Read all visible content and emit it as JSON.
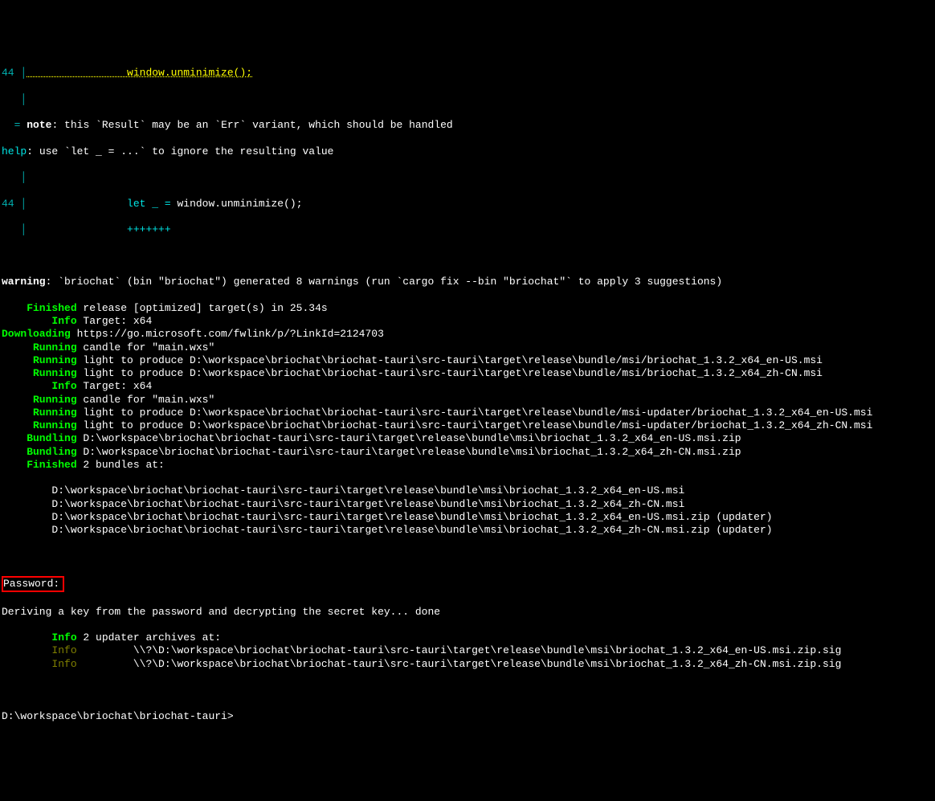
{
  "snippet": {
    "line_no": "44",
    "code_line": "                window.unminimize();",
    "note_eq": "  = ",
    "note_label": "note",
    "note_text": ": this `Result` may be an `Err` variant, which should be handled",
    "help_label": "help",
    "help_text": ": use `let _ = ...` to ignore the resulting value",
    "sugg_line_no": "44",
    "sugg_code_prefix": "                ",
    "sugg_code_insert": "let _ = ",
    "sugg_code_after": "window.unminimize();",
    "sugg_underline": "                +++++++"
  },
  "warning": {
    "label": "warning",
    "text": ": `briochat` (bin \"briochat\") generated 8 warnings (run `cargo fix --bin \"briochat\"` to apply 3 suggestions)"
  },
  "log": [
    {
      "label": "Finished",
      "pad": 12,
      "cls": "bright-green",
      "text": " release [optimized] target(s) in 25.34s"
    },
    {
      "label": "Info",
      "pad": 12,
      "cls": "bright-green",
      "text": " Target: x64"
    },
    {
      "label": "Downloading",
      "pad": 11,
      "cls": "bright-green",
      "text": " https://go.microsoft.com/fwlink/p/?LinkId=2124703"
    },
    {
      "label": "Running",
      "pad": 12,
      "cls": "bright-green",
      "text": " candle for \"main.wxs\""
    },
    {
      "label": "Running",
      "pad": 12,
      "cls": "bright-green",
      "text": " light to produce D:\\workspace\\briochat\\briochat-tauri\\src-tauri\\target\\release\\bundle/msi/briochat_1.3.2_x64_en-US.msi"
    },
    {
      "label": "Running",
      "pad": 12,
      "cls": "bright-green",
      "text": " light to produce D:\\workspace\\briochat\\briochat-tauri\\src-tauri\\target\\release\\bundle/msi/briochat_1.3.2_x64_zh-CN.msi"
    },
    {
      "label": "Info",
      "pad": 12,
      "cls": "bright-green",
      "text": " Target: x64"
    },
    {
      "label": "Running",
      "pad": 12,
      "cls": "bright-green",
      "text": " candle for \"main.wxs\""
    },
    {
      "label": "Running",
      "pad": 12,
      "cls": "bright-green",
      "text": " light to produce D:\\workspace\\briochat\\briochat-tauri\\src-tauri\\target\\release\\bundle/msi-updater/briochat_1.3.2_x64_en-US.msi"
    },
    {
      "label": "Running",
      "pad": 12,
      "cls": "bright-green",
      "text": " light to produce D:\\workspace\\briochat\\briochat-tauri\\src-tauri\\target\\release\\bundle/msi-updater/briochat_1.3.2_x64_zh-CN.msi"
    },
    {
      "label": "Bundling",
      "pad": 12,
      "cls": "bright-green",
      "text": " D:\\workspace\\briochat\\briochat-tauri\\src-tauri\\target\\release\\bundle\\msi\\briochat_1.3.2_x64_en-US.msi.zip"
    },
    {
      "label": "Bundling",
      "pad": 12,
      "cls": "bright-green",
      "text": " D:\\workspace\\briochat\\briochat-tauri\\src-tauri\\target\\release\\bundle\\msi\\briochat_1.3.2_x64_zh-CN.msi.zip"
    },
    {
      "label": "Finished",
      "pad": 12,
      "cls": "bright-green",
      "text": " 2 bundles at:"
    }
  ],
  "paths": [
    "        D:\\workspace\\briochat\\briochat-tauri\\src-tauri\\target\\release\\bundle\\msi\\briochat_1.3.2_x64_en-US.msi",
    "        D:\\workspace\\briochat\\briochat-tauri\\src-tauri\\target\\release\\bundle\\msi\\briochat_1.3.2_x64_zh-CN.msi",
    "        D:\\workspace\\briochat\\briochat-tauri\\src-tauri\\target\\release\\bundle\\msi\\briochat_1.3.2_x64_en-US.msi.zip (updater)",
    "        D:\\workspace\\briochat\\briochat-tauri\\src-tauri\\target\\release\\bundle\\msi\\briochat_1.3.2_x64_zh-CN.msi.zip (updater)"
  ],
  "password_prompt": "Password:",
  "deriving": "Deriving a key from the password and decrypting the secret key... done",
  "info2": [
    {
      "label": "Info",
      "pad": 12,
      "cls": "bright-green",
      "text": " 2 updater archives at:"
    },
    {
      "label": "Info",
      "pad": 12,
      "cls": "dim-green",
      "text": "         \\\\?\\D:\\workspace\\briochat\\briochat-tauri\\src-tauri\\target\\release\\bundle\\msi\\briochat_1.3.2_x64_en-US.msi.zip.sig"
    },
    {
      "label": "Info",
      "pad": 12,
      "cls": "dim-green",
      "text": "         \\\\?\\D:\\workspace\\briochat\\briochat-tauri\\src-tauri\\target\\release\\bundle\\msi\\briochat_1.3.2_x64_zh-CN.msi.zip.sig"
    }
  ],
  "prompt": "D:\\workspace\\briochat\\briochat-tauri>",
  "colors": {
    "highlight": "#ff0000"
  }
}
